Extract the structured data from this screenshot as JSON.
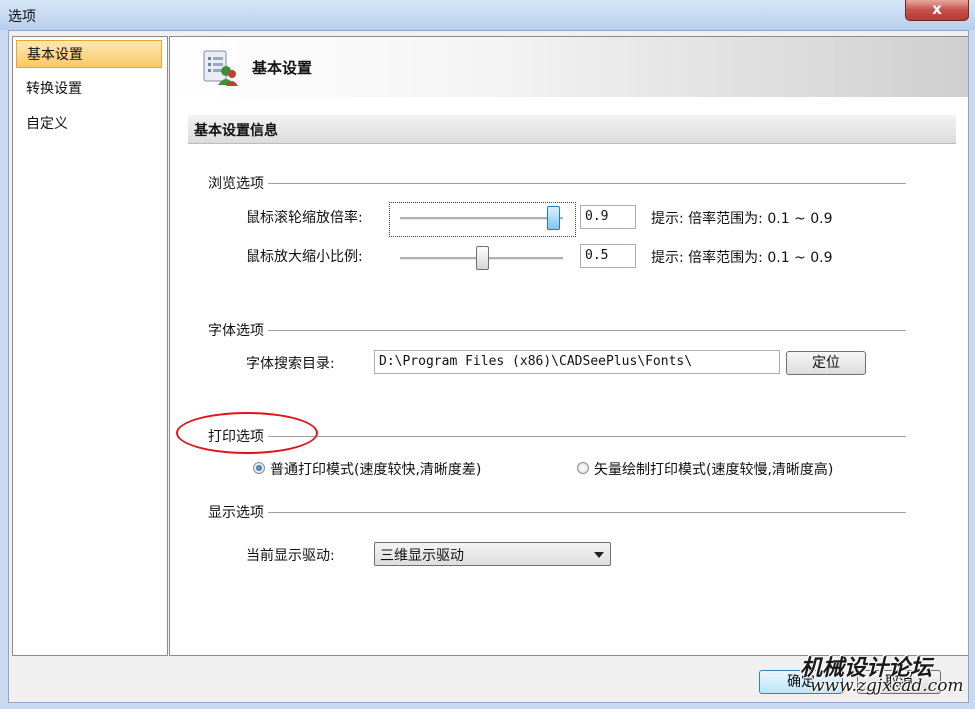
{
  "window": {
    "title": "选项",
    "close_glyph": "x"
  },
  "nav": {
    "items": [
      "基本设置",
      "转换设置",
      "自定义"
    ],
    "selected": "基本设置"
  },
  "header": {
    "title": "基本设置",
    "icon": "settings-users-icon"
  },
  "section": {
    "title": "基本设置信息"
  },
  "browse": {
    "title": "浏览选项",
    "wheel": {
      "label": "鼠标滚轮缩放倍率:",
      "value": "0.9",
      "slider_fraction": 0.9,
      "hint": "提示: 倍率范围为: 0.1 ~ 0.9"
    },
    "zoom": {
      "label": "鼠标放大缩小比例:",
      "value": "0.5",
      "slider_fraction": 0.5,
      "hint": "提示: 倍率范围为: 0.1 ~ 0.9"
    }
  },
  "font": {
    "title": "字体选项",
    "label": "字体搜索目录:",
    "path": "D:\\Program Files (x86)\\CADSeePlus\\Fonts\\",
    "locate_button": "定位"
  },
  "print": {
    "title": "打印选项",
    "option_normal": "普通打印模式(速度较快,清晰度差)",
    "option_vector": "矢量绘制打印模式(速度较慢,清晰度高)",
    "selected": "normal",
    "annotation_color": "#e0141b"
  },
  "display": {
    "title": "显示选项",
    "label": "当前显示驱动:",
    "driver": "三维显示驱动"
  },
  "footer": {
    "ok": "确定",
    "cancel": "取消"
  },
  "watermark": {
    "title": "机械设计论坛",
    "url": "www.zgjxcad.com"
  }
}
